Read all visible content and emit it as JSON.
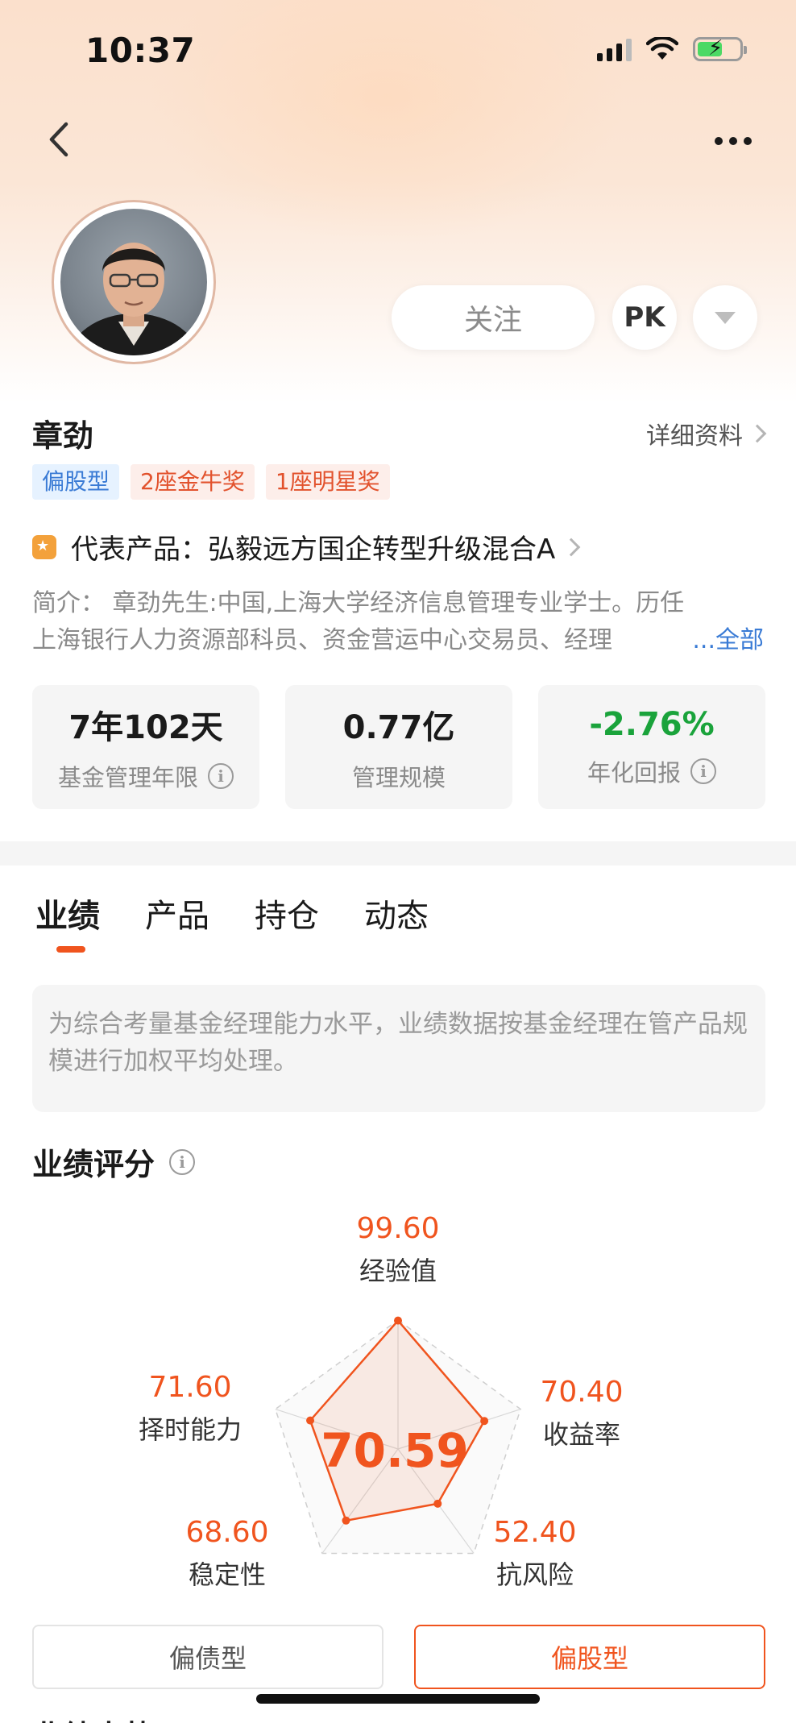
{
  "status_bar": {
    "time": "10:37"
  },
  "colors": {
    "accent": "#f0541e",
    "positive": "#1aa33b",
    "link": "#3a7bd5"
  },
  "icons": {
    "back": "chevron-left-icon",
    "more": "more-horizontal-icon",
    "dropdown": "triangle-down-icon",
    "info": "info-icon",
    "medal": "medal-icon"
  },
  "header": {
    "follow_label": "关注",
    "pk_label": "PK"
  },
  "manager": {
    "name": "章劲",
    "detail_label": "详细资料",
    "tags": [
      "偏股型",
      "2座金牛奖",
      "1座明星奖"
    ],
    "representative": "代表产品：弘毅远方国企转型升级混合A",
    "intro_line1": "简介：  章劲先生:中国,上海大学经济信息管理专业学士。历任",
    "intro_line2": "上海银行人力资源部科员、资金营运中心交易员、经理",
    "intro_more": "...全部"
  },
  "stats": [
    {
      "value": "7年102天",
      "label": "基金管理年限"
    },
    {
      "value": "0.77亿",
      "label": "管理规模"
    },
    {
      "value": "-2.76%",
      "label": "年化回报"
    }
  ],
  "tabs": [
    "业绩",
    "产品",
    "持仓",
    "动态"
  ],
  "notice": "为综合考量基金经理能力水平，业绩数据按基金经理在管产品规模进行加权平均处理。",
  "score_section": {
    "title": "业绩评分",
    "total": "70.59",
    "dimensions": [
      {
        "name": "经验值",
        "score": "99.60",
        "value": 99.6
      },
      {
        "name": "收益率",
        "score": "70.40",
        "value": 70.4
      },
      {
        "name": "抗风险",
        "score": "52.40",
        "value": 52.4
      },
      {
        "name": "稳定性",
        "score": "68.60",
        "value": 68.6
      },
      {
        "name": "择时能力",
        "score": "71.60",
        "value": 71.6
      }
    ],
    "type_buttons": [
      "偏债型",
      "偏股型"
    ],
    "type_selected": "偏股型"
  },
  "next_section_title": "业绩走势"
}
